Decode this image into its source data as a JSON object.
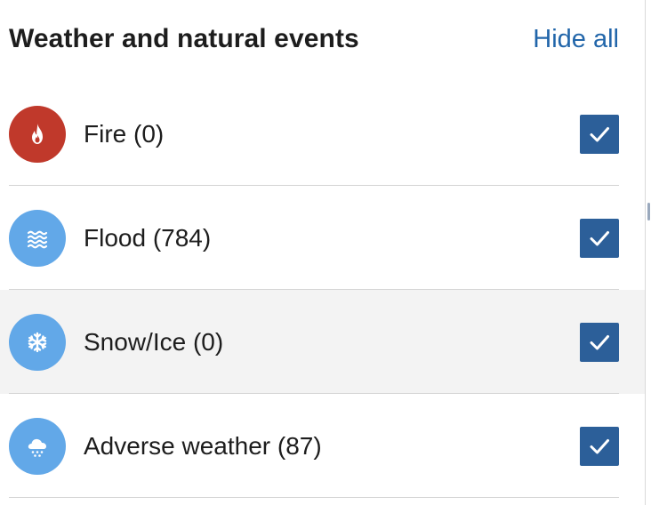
{
  "header": {
    "title": "Weather and natural events",
    "hide_all_label": "Hide all"
  },
  "colors": {
    "fire": "#c0392b",
    "flood": "#62a8e8",
    "snow_ice": "#62a8e8",
    "adverse_weather": "#62a8e8",
    "checkbox": "#2c5f99",
    "link": "#2266aa"
  },
  "events": [
    {
      "label": "Fire (0)",
      "icon": "fire-icon",
      "checked": true
    },
    {
      "label": "Flood (784)",
      "icon": "flood-icon",
      "checked": true
    },
    {
      "label": "Snow/Ice (0)",
      "icon": "snowflake-icon",
      "checked": true
    },
    {
      "label": "Adverse weather (87)",
      "icon": "rain-cloud-icon",
      "checked": true
    }
  ]
}
